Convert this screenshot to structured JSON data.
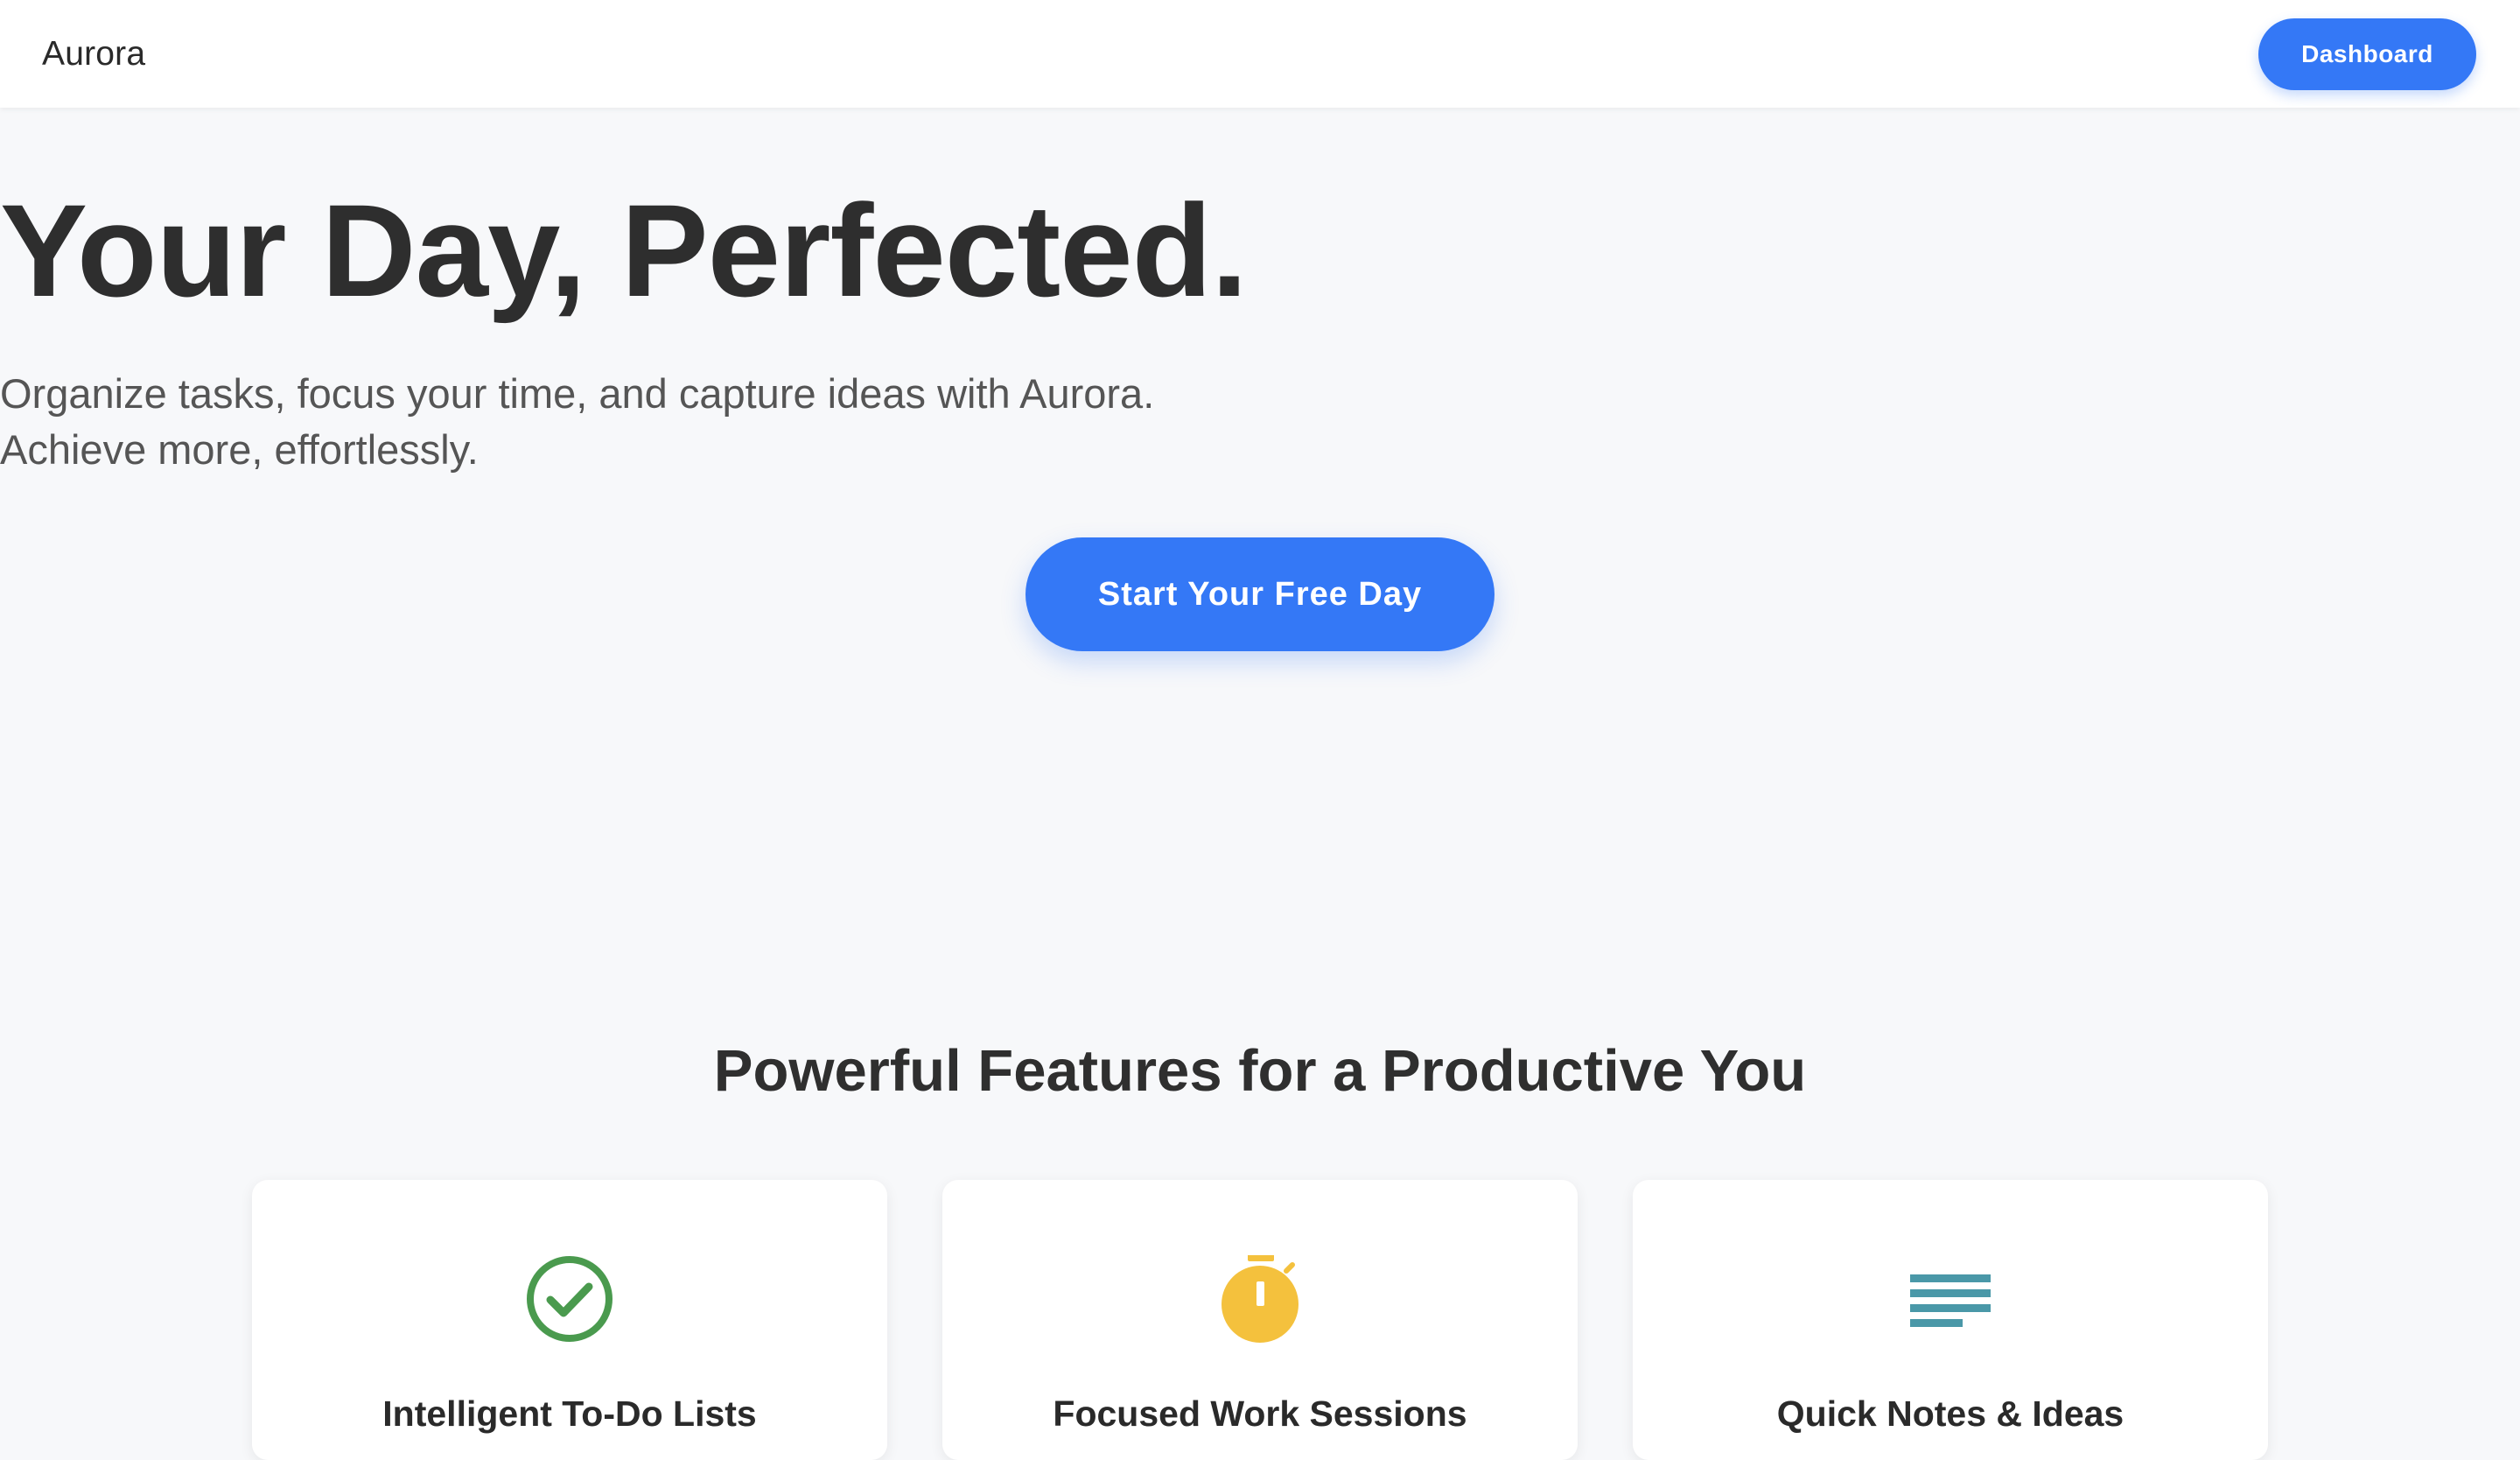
{
  "header": {
    "brand": "Aurora",
    "dashboard_label": "Dashboard"
  },
  "hero": {
    "title": "Your Day, Perfected.",
    "subtitle_line1": "Organize tasks, focus your time, and capture ideas with Aurora.",
    "subtitle_line2": "Achieve more, effortlessly.",
    "cta_label": "Start Your Free Day"
  },
  "features": {
    "title": "Powerful Features for a Productive You",
    "cards": [
      {
        "title": "Intelligent To-Do Lists",
        "icon": "check-circle-icon",
        "color": "#4a9a4e"
      },
      {
        "title": "Focused Work Sessions",
        "icon": "stopwatch-icon",
        "color": "#f4c13d"
      },
      {
        "title": "Quick Notes & Ideas",
        "icon": "notes-lines-icon",
        "color": "#4a98a8"
      }
    ]
  },
  "colors": {
    "accent": "#3478f6",
    "background": "#f7f8fa"
  }
}
